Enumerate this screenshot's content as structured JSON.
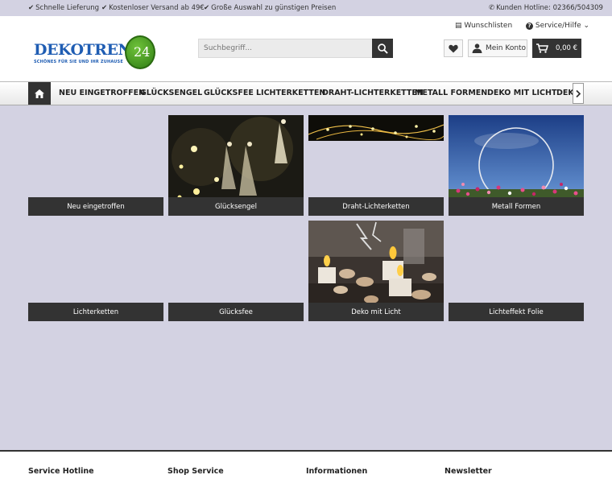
{
  "topbar": {
    "usp1": "Schnelle Lieferung",
    "usp2": "Kostenloser Versand ab 49€",
    "usp3": "Große Auswahl zu günstigen Preisen",
    "hotline": "Kunden Hotline: 02366/504309"
  },
  "logo": {
    "word": "DEKOTREND",
    "number": "24",
    "tagline": "SCHÖNES FÜR SIE UND IHR ZUHAUSE"
  },
  "header": {
    "wishlist": "Wunschlisten",
    "service": "Service/Hilfe",
    "search_placeholder": "Suchbegriff...",
    "account": "Mein Konto",
    "cart": "0,00 €"
  },
  "nav": {
    "items": [
      "NEU EINGETROFFEN",
      "GLÜCKSENGEL",
      "GLÜCKSFEE",
      "LICHTERKETTEN",
      "DRAHT-LICHTERKETTEN",
      "METALL FORMEN",
      "DEKO MIT LICHT",
      "DEKO"
    ]
  },
  "tiles": [
    "Neu eingetroffen",
    "Glücksengel",
    "Draht-Lichterketten",
    "Metall Formen",
    "Lichterketten",
    "Glücksfee",
    "Deko mit Licht",
    "Lichteffekt Folie"
  ],
  "footer": {
    "col1": "Service Hotline",
    "col2": "Shop Service",
    "col3": "Informationen",
    "col4": "Newsletter"
  },
  "colors": {
    "accent": "#333333",
    "background": "#d3d2e2",
    "logo_blue": "#1f5db3",
    "logo_green": "#3f9a1f"
  },
  "icons": [
    "check-icon",
    "phone-icon",
    "list-icon",
    "help-icon",
    "search-icon",
    "heart-icon",
    "user-icon",
    "cart-icon",
    "home-icon",
    "chevron-right-icon"
  ]
}
